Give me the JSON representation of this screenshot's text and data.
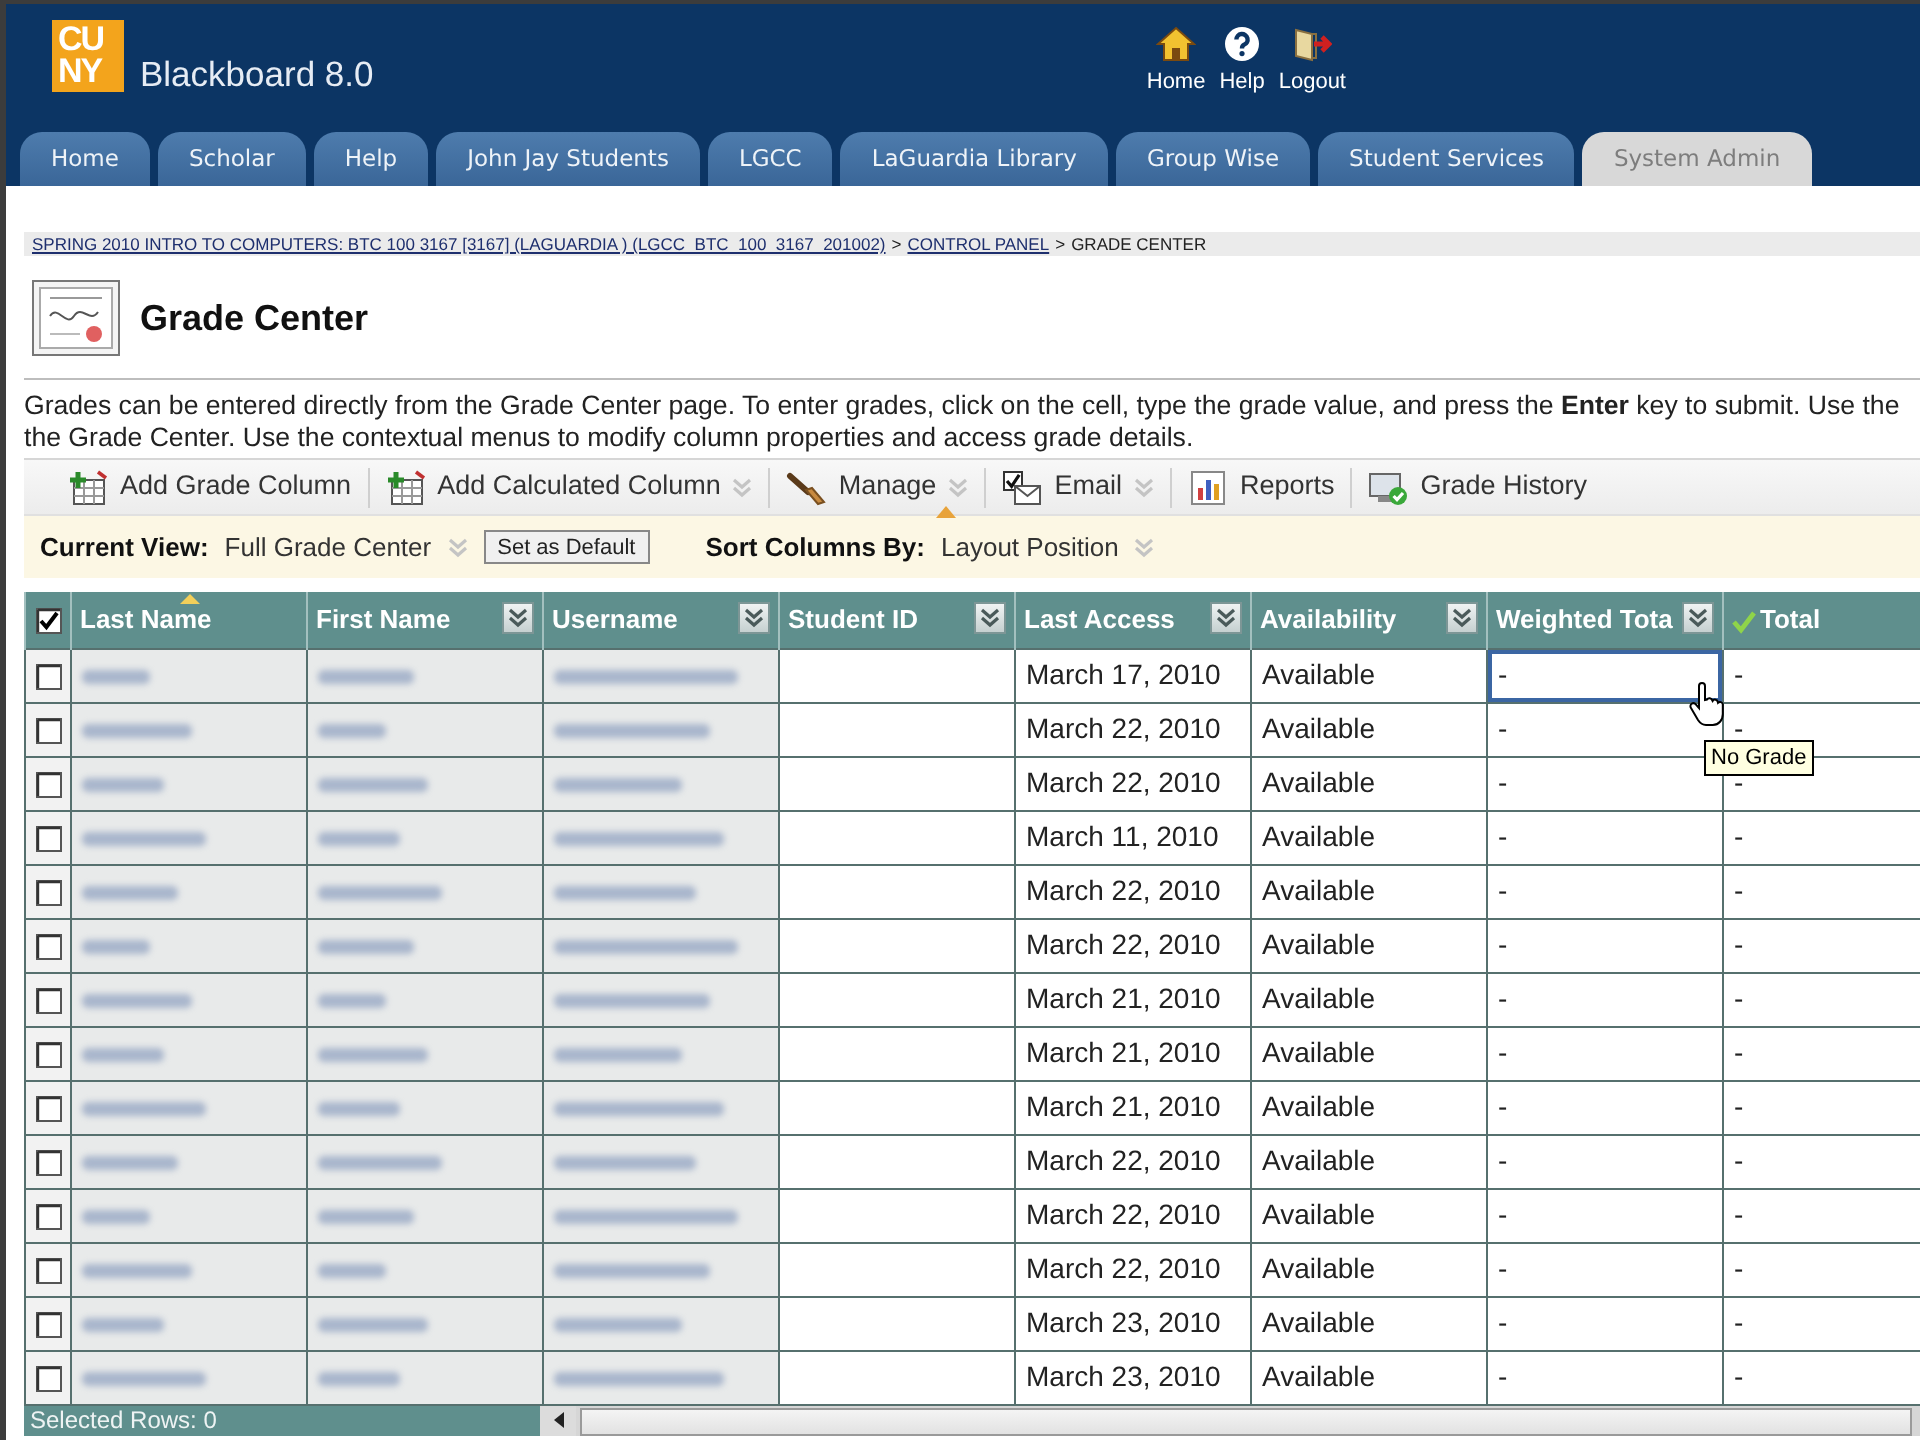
{
  "header": {
    "logo": [
      "CU",
      "NY"
    ],
    "product": "Blackboard 8.0",
    "links": [
      {
        "label": "Home",
        "kind": "home"
      },
      {
        "label": "Help",
        "kind": "help"
      },
      {
        "label": "Logout",
        "kind": "logout"
      }
    ]
  },
  "tabs": [
    {
      "label": "Home",
      "selected": false
    },
    {
      "label": "Scholar",
      "selected": false
    },
    {
      "label": "Help",
      "selected": false
    },
    {
      "label": "John Jay Students",
      "selected": false
    },
    {
      "label": "LGCC",
      "selected": false
    },
    {
      "label": "LaGuardia Library",
      "selected": false
    },
    {
      "label": "Group Wise",
      "selected": false
    },
    {
      "label": "Student Services",
      "selected": false
    },
    {
      "label": "System Admin",
      "selected": true
    }
  ],
  "breadcrumb": {
    "separator": ">",
    "items": [
      {
        "label": "SPRING 2010 INTRO TO COMPUTERS: BTC 100 3167 [3167] (LAGUARDIA ) (LGCC_BTC_100_3167_201002)",
        "link": true
      },
      {
        "label": "CONTROL PANEL",
        "link": true
      },
      {
        "label": "GRADE CENTER",
        "link": false
      }
    ]
  },
  "page_title": "Grade Center",
  "instructions": [
    "Grades can be entered directly from the Grade Center page. To enter grades, click on the cell, type the grade value, and press the **Enter** key to submit. Use the",
    "the Grade Center. Use the contextual menus to modify column properties and access grade details."
  ],
  "toolbar": [
    {
      "label": "Add Grade Column",
      "kind": "add-column",
      "menu": false
    },
    {
      "label": "Add Calculated Column",
      "kind": "calculated-column",
      "menu": true
    },
    {
      "label": "Manage",
      "kind": "manage",
      "menu": true
    },
    {
      "label": "Email",
      "kind": "email",
      "menu": true
    },
    {
      "label": "Reports",
      "kind": "reports",
      "menu": false
    },
    {
      "label": "Grade History",
      "kind": "history",
      "menu": false
    }
  ],
  "view_bar": {
    "current_view_label": "Current View:",
    "current_view": "Full Grade Center",
    "set_default_button": "Set as Default",
    "sort_label": "Sort Columns By:",
    "sort_value": "Layout Position"
  },
  "table": {
    "select_all_checked": true,
    "columns": [
      {
        "label": "Last Name",
        "kind": "blurred",
        "sorted": true,
        "menu": false,
        "check_mark": false
      },
      {
        "label": "First Name",
        "kind": "blurred",
        "sorted": false,
        "menu": true,
        "check_mark": false
      },
      {
        "label": "Username",
        "kind": "blurred",
        "sorted": false,
        "menu": true,
        "check_mark": false
      },
      {
        "label": "Student ID",
        "kind": "blank",
        "sorted": false,
        "menu": true,
        "check_mark": false
      },
      {
        "label": "Last Access",
        "kind": "text",
        "sorted": false,
        "menu": true,
        "check_mark": false
      },
      {
        "label": "Availability",
        "kind": "text",
        "sorted": false,
        "menu": true,
        "check_mark": false
      },
      {
        "label": "Weighted Tota",
        "kind": "text",
        "sorted": false,
        "menu": true,
        "check_mark": false
      },
      {
        "label": "Total",
        "kind": "text",
        "sorted": false,
        "menu": false,
        "check_mark": true
      }
    ],
    "rows": [
      {
        "checked": false,
        "focused": true,
        "tooltip": "No Grade",
        "cells": [
          "March 17, 2010",
          "Available",
          "-",
          "-"
        ]
      },
      {
        "checked": false,
        "focused": false,
        "cells": [
          "March 22, 2010",
          "Available",
          "-",
          "-"
        ]
      },
      {
        "checked": false,
        "focused": false,
        "cells": [
          "March 22, 2010",
          "Available",
          "-",
          "-"
        ]
      },
      {
        "checked": false,
        "focused": false,
        "cells": [
          "March 11, 2010",
          "Available",
          "-",
          "-"
        ]
      },
      {
        "checked": false,
        "focused": false,
        "cells": [
          "March 22, 2010",
          "Available",
          "-",
          "-"
        ]
      },
      {
        "checked": false,
        "focused": false,
        "cells": [
          "March 22, 2010",
          "Available",
          "-",
          "-"
        ]
      },
      {
        "checked": false,
        "focused": false,
        "cells": [
          "March 21, 2010",
          "Available",
          "-",
          "-"
        ]
      },
      {
        "checked": false,
        "focused": false,
        "cells": [
          "March 21, 2010",
          "Available",
          "-",
          "-"
        ]
      },
      {
        "checked": false,
        "focused": false,
        "cells": [
          "March 21, 2010",
          "Available",
          "-",
          "-"
        ]
      },
      {
        "checked": false,
        "focused": false,
        "cells": [
          "March 22, 2010",
          "Available",
          "-",
          "-"
        ]
      },
      {
        "checked": false,
        "focused": false,
        "cells": [
          "March 22, 2010",
          "Available",
          "-",
          "-"
        ]
      },
      {
        "checked": false,
        "focused": false,
        "cells": [
          "March 22, 2010",
          "Available",
          "-",
          "-"
        ]
      },
      {
        "checked": false,
        "focused": false,
        "cells": [
          "March 23, 2010",
          "Available",
          "-",
          "-"
        ]
      },
      {
        "checked": false,
        "focused": false,
        "cells": [
          "March 23, 2010",
          "Available",
          "-",
          "-"
        ]
      }
    ]
  },
  "status_bar": {
    "selected_rows": "Selected Rows: 0"
  }
}
